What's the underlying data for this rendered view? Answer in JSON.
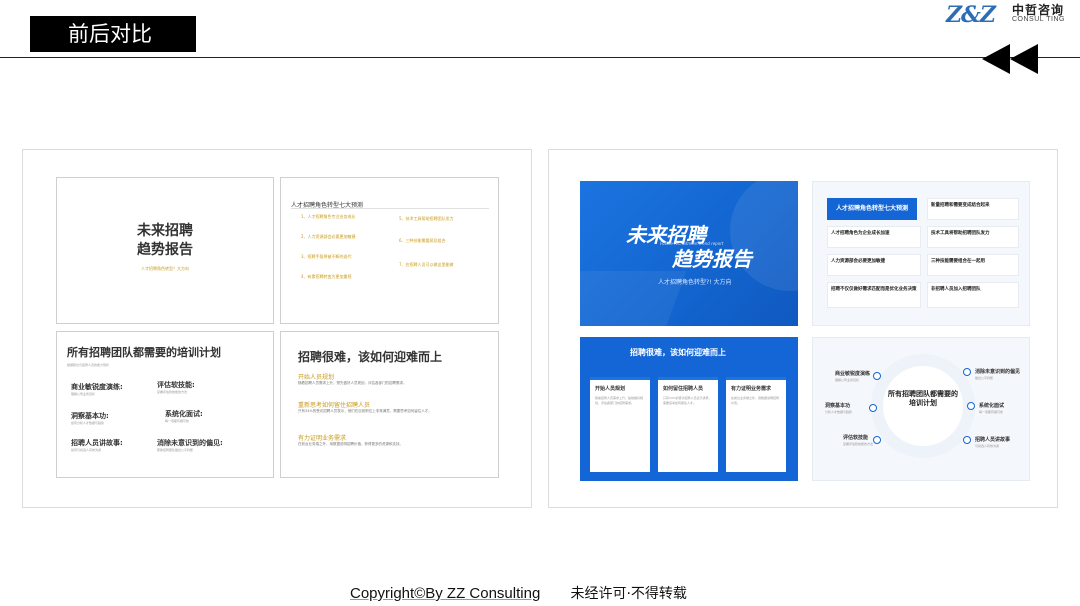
{
  "header": {
    "title": "前后对比",
    "logo_mark": "Z&Z",
    "logo_cn": "中哲咨询",
    "logo_en": "CONSUL TING"
  },
  "before": {
    "cover": {
      "title_line1": "未来招聘",
      "title_line2": "趋势报告",
      "subtitle": "人才招聘角色转型？大方向"
    },
    "roles": {
      "title": "人才招聘角色转型七大预测",
      "items": [
        "1、人才招聘角色专注业务成长",
        "2、人力资源部会必要更加敏捷",
        "3、招聘手段将被不断的迭代",
        "4、有素招聘转变为更加重视",
        "5、技术工具帮助招聘团队发力",
        "6、三种技能需要顾及组合",
        "7、应招聘人员可以做这里能做"
      ]
    },
    "training": {
      "title": "所有招聘团队都需要的培训计划",
      "subtitle": "根据职位与招聘人员的能力现状",
      "items": [
        {
          "label": "商业敏锐度演练:",
          "desc": "理解公司业务目标"
        },
        {
          "label": "评估软技能:",
          "desc": "掌握评估软技能的方法"
        },
        {
          "label": "洞察基本功:",
          "desc": "如何分析人才数据与趋势"
        },
        {
          "label": "系统化面试:",
          "desc": "每一项都有据可依"
        },
        {
          "label": "招聘人员讲故事:",
          "desc": "如何与候选人有效沟通"
        },
        {
          "label": "消除未意识到的偏见:",
          "desc": "帮助招聘团队做出公平判断"
        }
      ]
    },
    "hard": {
      "title": "招聘很难，该如何迎难而上",
      "sections": [
        {
          "head": "开始人员规划",
          "body": "随着招聘人员需求上升，预先做好人员规划，评估各部门的招聘需求。"
        },
        {
          "head": "重新思考如何留住招聘人员",
          "body": "只有34%的受访招聘人员表示，他们在目前职位上非常满意，需要思考如何留住人才。"
        },
        {
          "head": "有力证明业务需求",
          "body": "在前台业务端之外，用数据说明招聘价值，获得更多的资源和支持。"
        }
      ]
    }
  },
  "after": {
    "cover": {
      "title_line1": "未来招聘",
      "title_line2": "趋势报告",
      "en": "Future recruitment trend report",
      "subtitle": "人才招聘角色转型?! 大方向"
    },
    "roles": {
      "title": "人才招聘角色转型七大预测",
      "cards": [
        "新量招聘和需要变成结合起来",
        "人才招聘角色为企业成长加速",
        "技术工具将帮助招聘团队发力",
        "人力资源部会必要更加敏捷",
        "三种技能需要组合在一起用",
        "招聘不仅仅做好需求匹配而是优化业务决策",
        "非招聘人员加入招聘团队"
      ]
    },
    "hard": {
      "title": "招聘很难，该如何迎难而上",
      "cards": [
        {
          "title": "开始人员规划",
          "body": "随着招聘人员需求上升，提前做好规划，评估各部门的招聘需求。"
        },
        {
          "title": "如何留住招聘人员",
          "body": "只有34%的受访招聘人员表示满意，需要思考如何留住人才。"
        },
        {
          "title": "有力证明业务需求",
          "body": "在前台业务端之外，用数据说明招聘价值。"
        }
      ]
    },
    "training": {
      "center": "所有招聘团队都需要的培训计划",
      "items": [
        {
          "label": "商业敏锐度演练",
          "desc": "理解公司业务目标"
        },
        {
          "label": "洞察基本功",
          "desc": "分析人才数据与趋势"
        },
        {
          "label": "评估软技能",
          "desc": "掌握评估软技能的方法"
        },
        {
          "label": "消除未意识到的偏见",
          "desc": "做出公平判断"
        },
        {
          "label": "系统化面试",
          "desc": "每一项都有据可依"
        },
        {
          "label": "招聘人员讲故事",
          "desc": "与候选人有效沟通"
        }
      ]
    }
  },
  "footer": {
    "copyright": "Copyright©By ZZ Consulting",
    "notice": "未经许可·不得转载"
  }
}
